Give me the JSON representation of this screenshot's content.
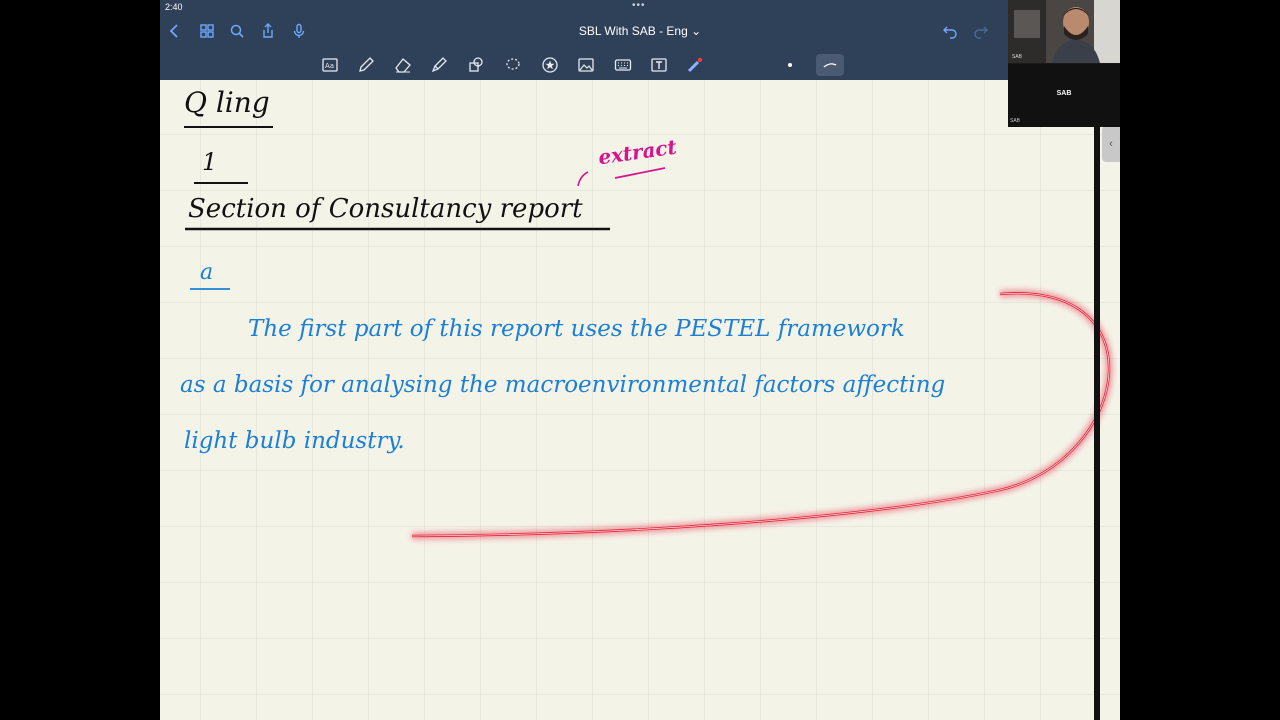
{
  "status": {
    "time": "2:40",
    "dots": "•••"
  },
  "nav": {
    "title": "SBL With SAB - Eng ⌄"
  },
  "video": {
    "self_label": "SAB",
    "tile_name": "SAB",
    "tile_label": "SAB"
  },
  "notes": {
    "heading": "Q ling",
    "number": "1",
    "section_title": "Section of Consultancy report",
    "annotation": "extract",
    "part": "a",
    "lines": [
      "The  first  part  of  this  report  uses  the  PESTEL  framework",
      "as  a  basis  for  analysing  the  macroenvironmental  factors  affecting",
      "light  bulb  industry."
    ]
  },
  "colors": {
    "navbar": "#2f4159",
    "paper": "#f4f3e8",
    "grid": "#d9dbd2",
    "ink_blue": "#1b7fd6",
    "ink_pink": "#d6148f",
    "laser": "#e3243b"
  }
}
